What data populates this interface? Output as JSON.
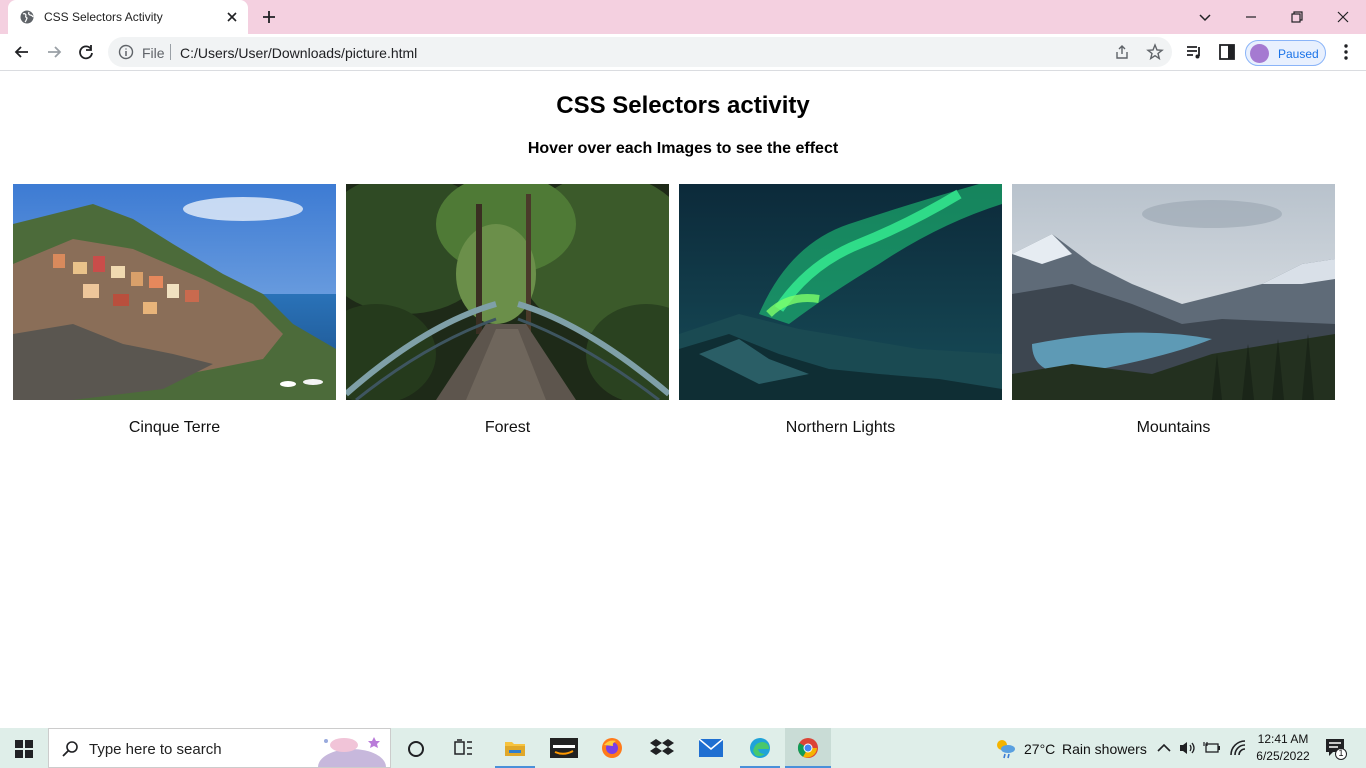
{
  "browser": {
    "tab": {
      "title": "CSS Selectors Activity"
    },
    "address": {
      "scheme_label": "File",
      "url": "C:/Users/User/Downloads/picture.html"
    },
    "profile": {
      "label": "Paused"
    }
  },
  "page": {
    "heading": "CSS Selectors activity",
    "subheading": "Hover over each Images to see the effect",
    "cards": [
      {
        "caption": "Cinque Terre",
        "image": "coastal-village-photo"
      },
      {
        "caption": "Forest",
        "image": "forest-bridge-photo"
      },
      {
        "caption": "Northern Lights",
        "image": "aurora-photo"
      },
      {
        "caption": "Mountains",
        "image": "mountain-lake-photo"
      }
    ]
  },
  "taskbar": {
    "search_placeholder": "Type here to search",
    "weather": {
      "temp": "27°C",
      "condition": "Rain showers"
    },
    "clock": {
      "time": "12:41 AM",
      "date": "6/25/2022"
    },
    "notification_count": "1"
  },
  "colors": {
    "tabstrip": "#f4d0e0",
    "taskbar": "#dfeee9",
    "accent": "#1a73e8"
  }
}
